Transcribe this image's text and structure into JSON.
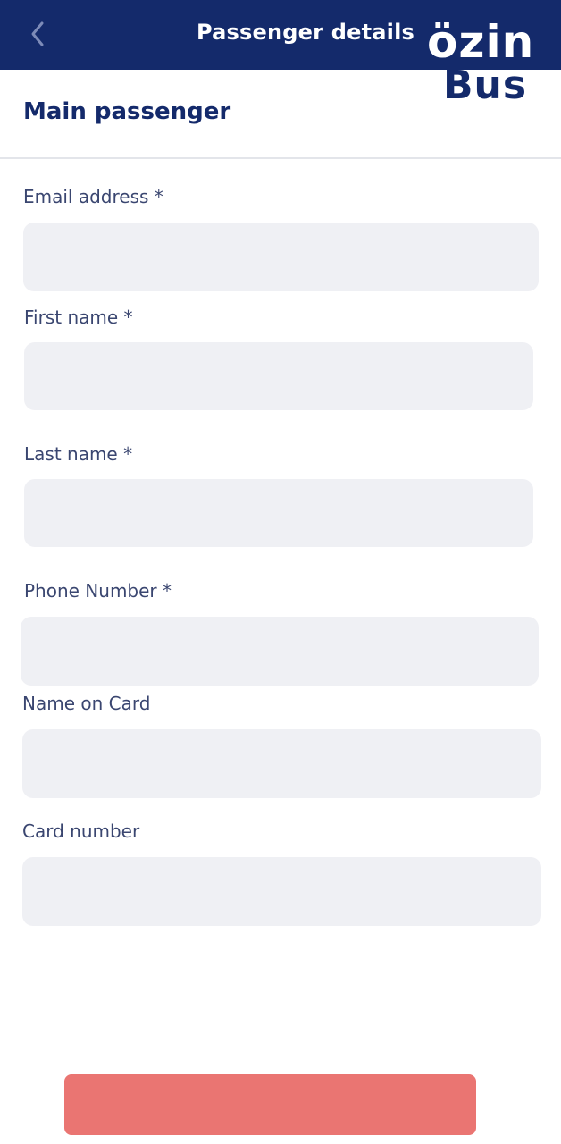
{
  "header": {
    "title": "Passenger details",
    "back_icon": "chevron-left-icon",
    "background_color": "#142a6b"
  },
  "logo": {
    "line1": "özin",
    "line2": "Bus"
  },
  "section": {
    "title": "Main passenger"
  },
  "form": {
    "email": {
      "label": "Email address *",
      "value": "",
      "placeholder": ""
    },
    "first_name": {
      "label": "First name *",
      "value": "",
      "placeholder": ""
    },
    "last_name": {
      "label": "Last name *",
      "value": "",
      "placeholder": ""
    },
    "phone": {
      "label": "Phone Number *",
      "value": "",
      "placeholder": ""
    },
    "name_on_card": {
      "label": "Name on Card",
      "value": "",
      "placeholder": ""
    },
    "card_number": {
      "label": "Card number",
      "value": "",
      "placeholder": ""
    }
  },
  "footer": {
    "continue_label": "",
    "button_color": "#ea7572"
  },
  "colors": {
    "primary": "#142a6b",
    "field_background": "#eff0f4",
    "label": "#3a4670"
  }
}
